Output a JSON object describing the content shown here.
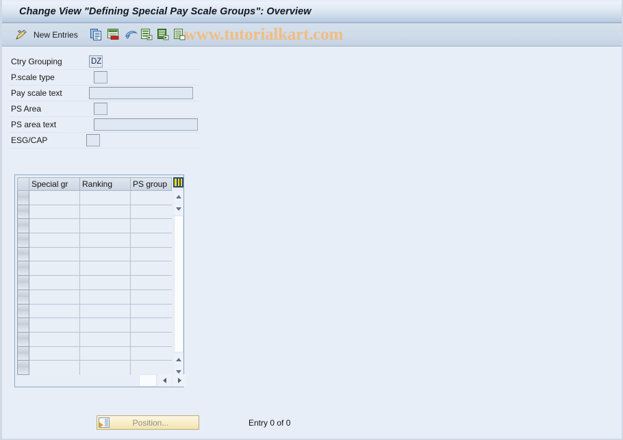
{
  "window": {
    "title": "Change View \"Defining Special Pay Scale Groups\": Overview"
  },
  "toolbar": {
    "pencil_icon": "pencil-icon",
    "new_entries_label": "New Entries",
    "icons": [
      {
        "name": "copy-icon",
        "title": "Copy As..."
      },
      {
        "name": "delete-icon",
        "title": "Delete"
      },
      {
        "name": "undo-icon",
        "title": "Undo Change"
      },
      {
        "name": "select-all-icon",
        "title": "Select All"
      },
      {
        "name": "select-block-icon",
        "title": "Select Block"
      },
      {
        "name": "deselect-all-icon",
        "title": "Deselect All"
      }
    ],
    "watermark": "www.tutorialkart.com"
  },
  "form": {
    "rows": [
      {
        "label": "Ctry Grouping",
        "value": "DZ",
        "field": "tiny",
        "placeholder": ""
      },
      {
        "label": "P.scale type",
        "value": "",
        "field": "tiny2",
        "placeholder": ""
      },
      {
        "label": "Pay scale text",
        "value": "",
        "field": "wide",
        "placeholder": ""
      },
      {
        "label": "PS Area",
        "value": "",
        "field": "tiny2",
        "placeholder": ""
      },
      {
        "label": "PS area text",
        "value": "",
        "field": "wide2",
        "placeholder": ""
      },
      {
        "label": "ESG/CAP",
        "value": "",
        "field": "tiny3",
        "placeholder": ""
      }
    ]
  },
  "table": {
    "columns": [
      "Special gr",
      "Ranking",
      "PS group"
    ],
    "config_icon": "table-settings-icon",
    "rows": [
      {
        "special_gr": "",
        "ranking": "",
        "ps_group": ""
      },
      {
        "special_gr": "",
        "ranking": "",
        "ps_group": ""
      },
      {
        "special_gr": "",
        "ranking": "",
        "ps_group": ""
      },
      {
        "special_gr": "",
        "ranking": "",
        "ps_group": ""
      },
      {
        "special_gr": "",
        "ranking": "",
        "ps_group": ""
      },
      {
        "special_gr": "",
        "ranking": "",
        "ps_group": ""
      },
      {
        "special_gr": "",
        "ranking": "",
        "ps_group": ""
      },
      {
        "special_gr": "",
        "ranking": "",
        "ps_group": ""
      },
      {
        "special_gr": "",
        "ranking": "",
        "ps_group": ""
      },
      {
        "special_gr": "",
        "ranking": "",
        "ps_group": ""
      },
      {
        "special_gr": "",
        "ranking": "",
        "ps_group": ""
      },
      {
        "special_gr": "",
        "ranking": "",
        "ps_group": ""
      },
      {
        "special_gr": "",
        "ranking": "",
        "ps_group": ""
      }
    ],
    "scroll": {
      "up_icon": "scroll-up-icon",
      "down_icon": "scroll-down-icon",
      "left_icon": "scroll-left-icon",
      "right_icon": "scroll-right-icon"
    }
  },
  "footer": {
    "position_button_label": "Position...",
    "position_icon": "position-icon",
    "entry_status": "Entry 0 of 0"
  },
  "colors": {
    "page_background": "#e8eef7",
    "titlebar_top": "#eef3fa",
    "titlebar_bottom": "#b9cbe0",
    "toolbar": "#cfdbe9",
    "watermark": "#f0bd84",
    "field_background": "#dfe8f3",
    "field_border": "#9aa9bb",
    "table_border": "#8ba6c4",
    "button_yellow": "#f7edc6",
    "accent_blue": "#2a4d73"
  }
}
